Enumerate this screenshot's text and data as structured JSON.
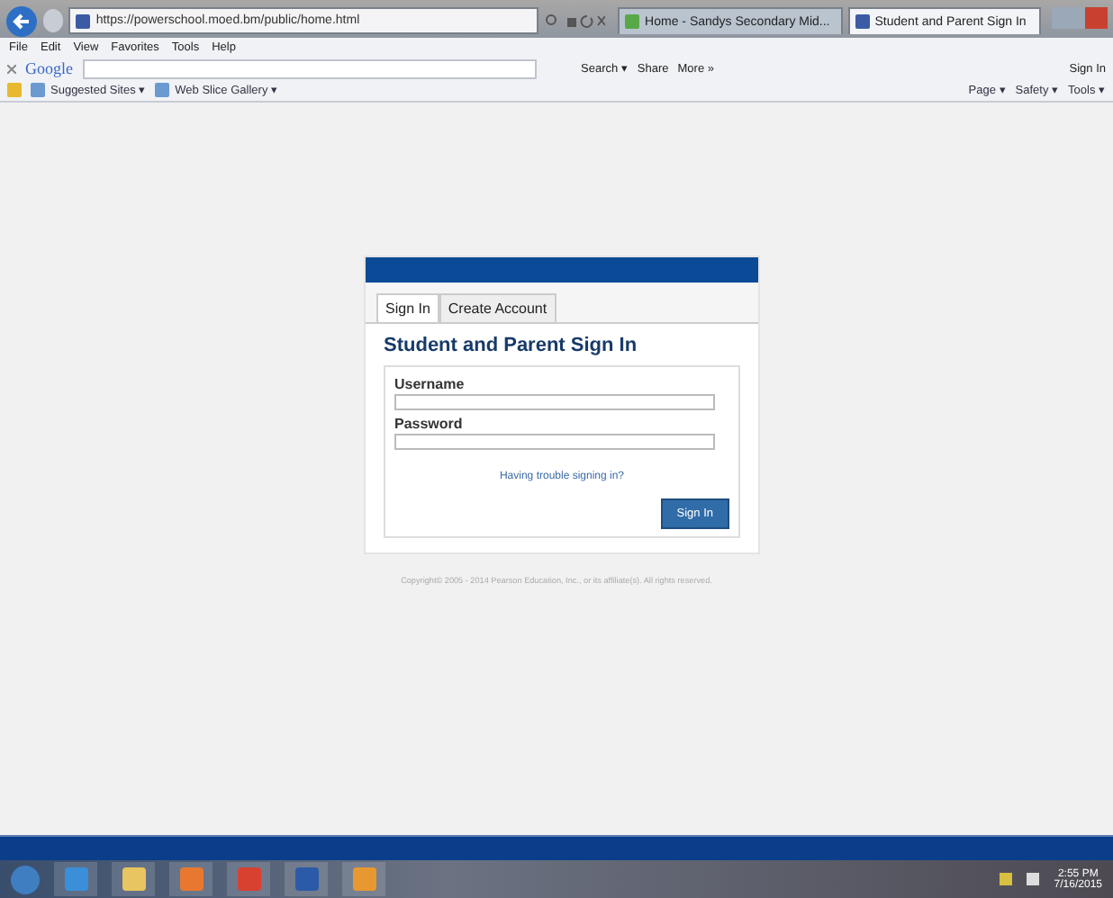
{
  "browser": {
    "address": "https://powerschool.moed.bm/public/home.html",
    "tabs": [
      {
        "label": "Home - Sandys Secondary Mid...",
        "selected": false
      },
      {
        "label": "Student and Parent Sign In",
        "selected": true
      }
    ],
    "menu": [
      "File",
      "Edit",
      "View",
      "Favorites",
      "Tools",
      "Help"
    ],
    "google_toolbar": {
      "logo": "Google",
      "buttons": [
        "Search ▾",
        "Share",
        "More »"
      ],
      "sign_in": "Sign In"
    },
    "favorites": [
      "Suggested Sites ▾",
      "Web Slice Gallery ▾"
    ],
    "command_bar": [
      "Page ▾",
      "Safety ▾",
      "Tools ▾"
    ]
  },
  "login": {
    "tabs": [
      {
        "label": "Sign In",
        "selected": true
      },
      {
        "label": "Create Account",
        "selected": false
      }
    ],
    "heading": "Student and Parent Sign In",
    "fields": [
      {
        "label": "Username"
      },
      {
        "label": "Password"
      }
    ],
    "help_link": "Having trouble signing in?",
    "button": "Sign In",
    "copyright": "Copyright© 2005 - 2014 Pearson Education, Inc., or its affiliate(s). All rights reserved."
  },
  "taskbar": {
    "time": "2:55 PM",
    "date": "7/16/2015"
  }
}
